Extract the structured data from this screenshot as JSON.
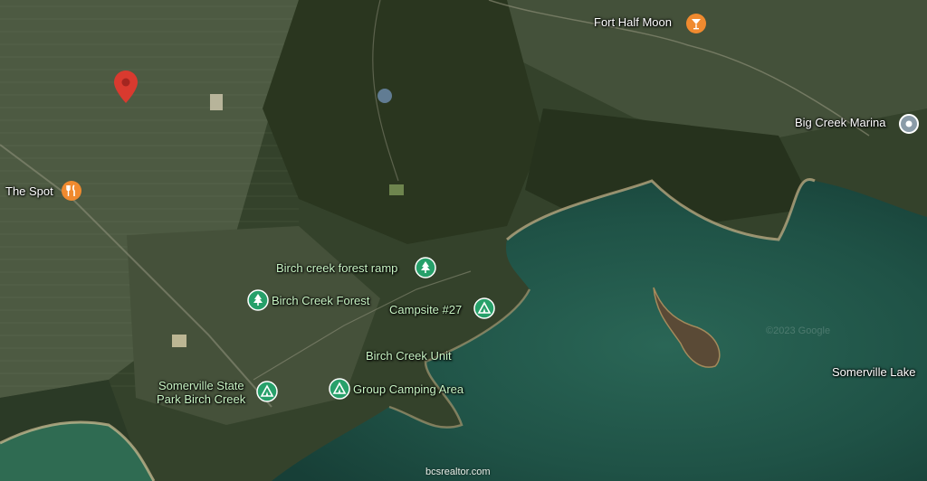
{
  "map": {
    "places": {
      "fort_half_moon": "Fort Half Moon",
      "big_creek_marina": "Big Creek Marina",
      "the_spot": "The Spot",
      "birch_creek_forest_ramp": "Birch creek forest ramp",
      "birch_creek_forest": "Birch Creek Forest",
      "campsite_27": "Campsite #27",
      "birch_creek_unit": "Birch Creek Unit",
      "somerville_state_park_line1": "Somerville State",
      "somerville_state_park_line2": "Park Birch Creek",
      "group_camping_area": "Group Camping Area",
      "somerville_lake": "Somerville Lake"
    },
    "watermark": "bcsrealtor.com",
    "faint_watermark": "©2023 Google",
    "icons": {
      "selected": "location-pin-icon",
      "restaurant": "fork-knife-icon",
      "bar": "cocktail-icon",
      "marina": "place-icon",
      "park": "tree-icon",
      "campground": "tent-icon"
    },
    "colors": {
      "pin_red": "#d93a2f",
      "food_orange": "#f08a2f",
      "park_green": "#27a06a",
      "water": "#1f5246",
      "land_dark": "#2b3822"
    }
  }
}
